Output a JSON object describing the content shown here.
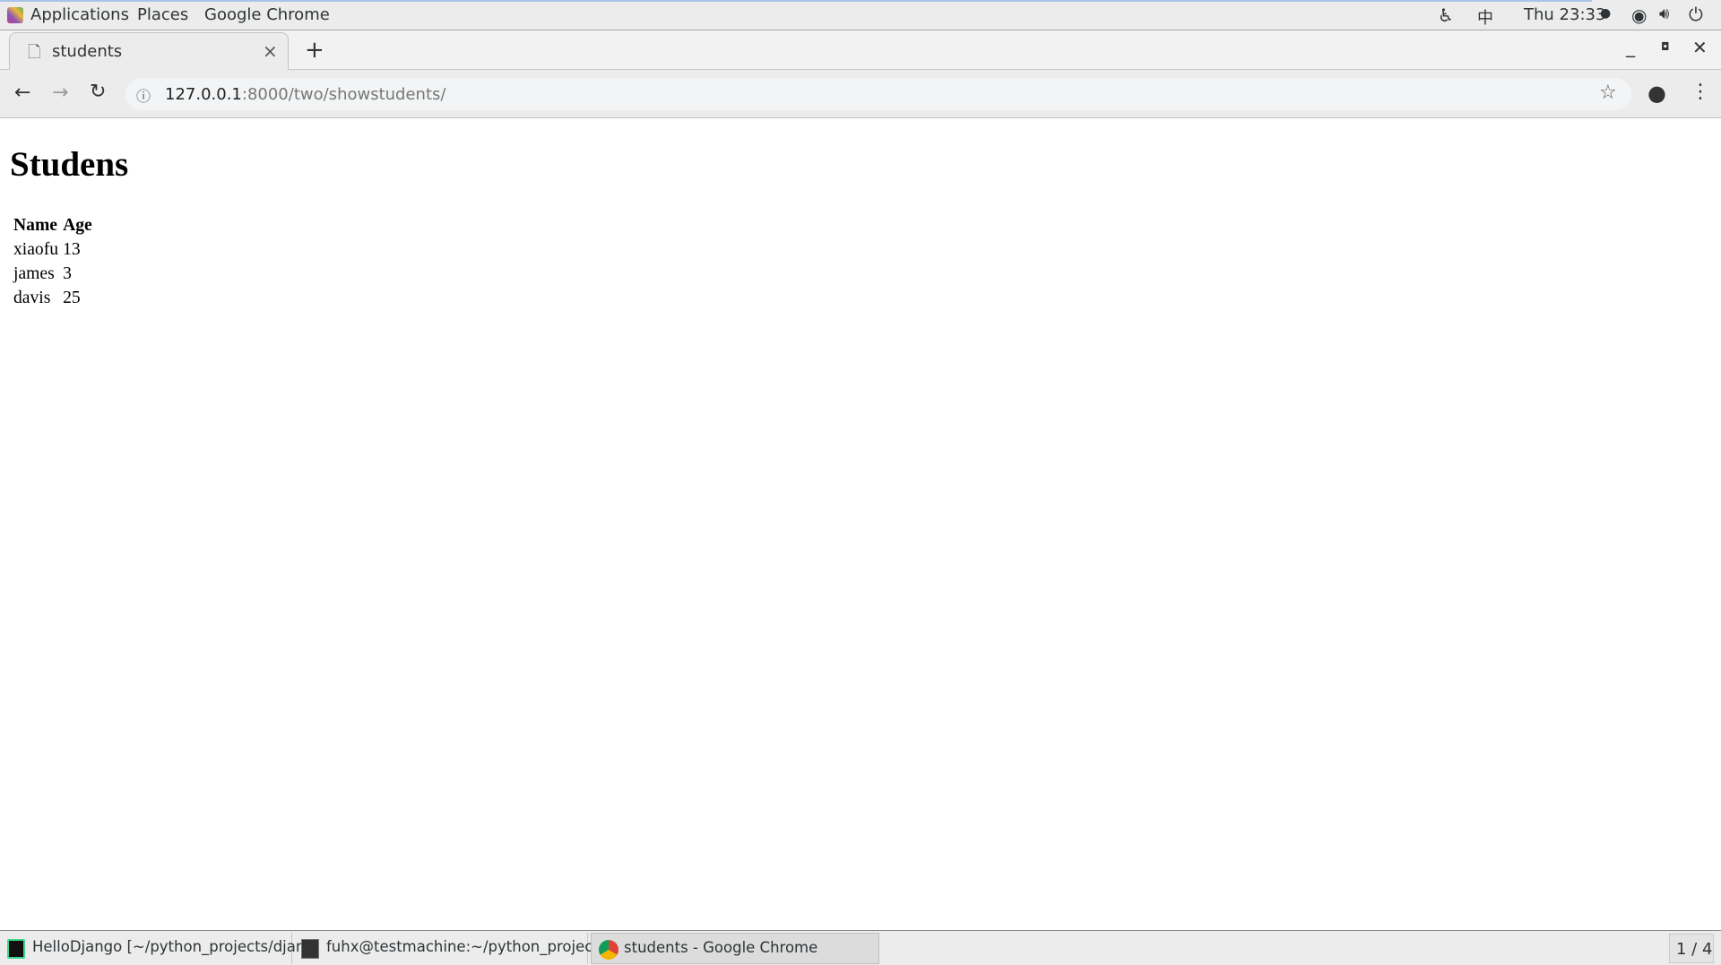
{
  "topbar": {
    "applications": "Applications",
    "places": "Places",
    "app": "Google Chrome",
    "input_method": "中",
    "clock": "Thu 23:33"
  },
  "browser": {
    "tab_title": "students",
    "url_host": "127.0.0.1",
    "url_rest": ":8000/two/showstudents/"
  },
  "page": {
    "heading": "Studens",
    "columns": [
      "Name",
      "Age"
    ],
    "rows": [
      [
        "xiaofu",
        "13"
      ],
      [
        "james",
        "3"
      ],
      [
        "davis",
        "25"
      ]
    ]
  },
  "taskbar": {
    "items": [
      "HelloDjango [~/python_projects/djan...",
      "fuhx@testmachine:~/python_project...",
      "students - Google Chrome"
    ],
    "workspace": "1 / 4"
  },
  "colors": {
    "accent": "#a9c4e6"
  }
}
